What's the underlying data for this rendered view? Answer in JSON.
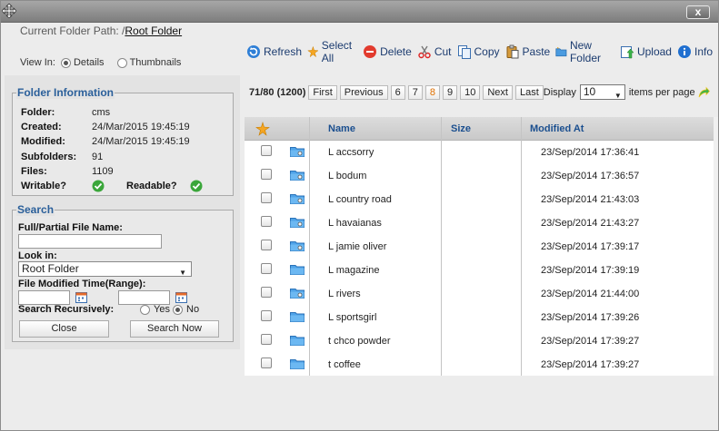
{
  "window": {
    "close_label": "x"
  },
  "path": {
    "label": "Current Folder Path: /",
    "link": "Root Folder"
  },
  "toolbar": {
    "buttons": [
      {
        "label": "Refresh",
        "icon": "refresh-icon"
      },
      {
        "label": "Select All",
        "icon": "select-all-icon"
      },
      {
        "label": "Delete",
        "icon": "delete-icon"
      },
      {
        "label": "Cut",
        "icon": "cut-icon"
      },
      {
        "label": "Copy",
        "icon": "copy-icon"
      },
      {
        "label": "Paste",
        "icon": "paste-icon"
      },
      {
        "label": "New Folder",
        "icon": "new-folder-icon"
      },
      {
        "label": "Upload",
        "icon": "upload-icon"
      },
      {
        "label": "Info",
        "icon": "info-icon"
      }
    ]
  },
  "view": {
    "label": "View In:",
    "details": "Details",
    "thumbnails": "Thumbnails",
    "selected": "Details"
  },
  "folder_info": {
    "title": "Folder Information",
    "rows": [
      {
        "key": "Folder:",
        "value": "cms"
      },
      {
        "key": "Created:",
        "value": "24/Mar/2015 19:45:19"
      },
      {
        "key": "Modified:",
        "value": "24/Mar/2015 19:45:19"
      },
      {
        "key": "Subfolders:",
        "value": "91"
      },
      {
        "key": "Files:",
        "value": "1109"
      }
    ],
    "writable_label": "Writable?",
    "readable_label": "Readable?"
  },
  "search": {
    "title": "Search",
    "name_label": "Full/Partial File Name:",
    "name_value": "",
    "look_in_label": "Look in:",
    "look_in_value": "Root Folder",
    "modified_label": "File Modified Time(Range):",
    "recursive_label": "Search Recursively:",
    "yes": "Yes",
    "no": "No",
    "recursive_selected": "No",
    "close_label": "Close",
    "search_label": "Search Now"
  },
  "pager": {
    "count": "71/80 (1200)",
    "first": "First",
    "previous": "Previous",
    "pages": [
      "6",
      "7",
      "8",
      "9",
      "10"
    ],
    "current_page": "8",
    "next": "Next",
    "last": "Last",
    "display_label": "Display",
    "display_value": "10",
    "items_per_page": "items per page"
  },
  "grid": {
    "columns": {
      "name": "Name",
      "size": "Size",
      "modified": "Modified At"
    },
    "rows": [
      {
        "name": "L accsorry",
        "size": "",
        "modified": "23/Sep/2014 17:36:41",
        "icon": "folder-search-icon"
      },
      {
        "name": "L bodum",
        "size": "",
        "modified": "23/Sep/2014 17:36:57",
        "icon": "folder-search-icon"
      },
      {
        "name": "L country road",
        "size": "",
        "modified": "23/Sep/2014 21:43:03",
        "icon": "folder-search-icon"
      },
      {
        "name": "L havaianas",
        "size": "",
        "modified": "23/Sep/2014 21:43:27",
        "icon": "folder-search-icon"
      },
      {
        "name": "L jamie oliver",
        "size": "",
        "modified": "23/Sep/2014 17:39:17",
        "icon": "folder-search-icon"
      },
      {
        "name": "L magazine",
        "size": "",
        "modified": "23/Sep/2014 17:39:19",
        "icon": "folder-icon"
      },
      {
        "name": "L rivers",
        "size": "",
        "modified": "23/Sep/2014 21:44:00",
        "icon": "folder-search-icon"
      },
      {
        "name": "L sportsgirl",
        "size": "",
        "modified": "23/Sep/2014 17:39:26",
        "icon": "folder-icon"
      },
      {
        "name": "t chco powder",
        "size": "",
        "modified": "23/Sep/2014 17:39:27",
        "icon": "folder-icon"
      },
      {
        "name": "t coffee",
        "size": "",
        "modified": "23/Sep/2014 17:39:27",
        "icon": "folder-icon"
      }
    ]
  },
  "colors": {
    "accent": "#2a5f9a",
    "current_page": "#e07000",
    "titlebar": "#8f8f8f"
  }
}
